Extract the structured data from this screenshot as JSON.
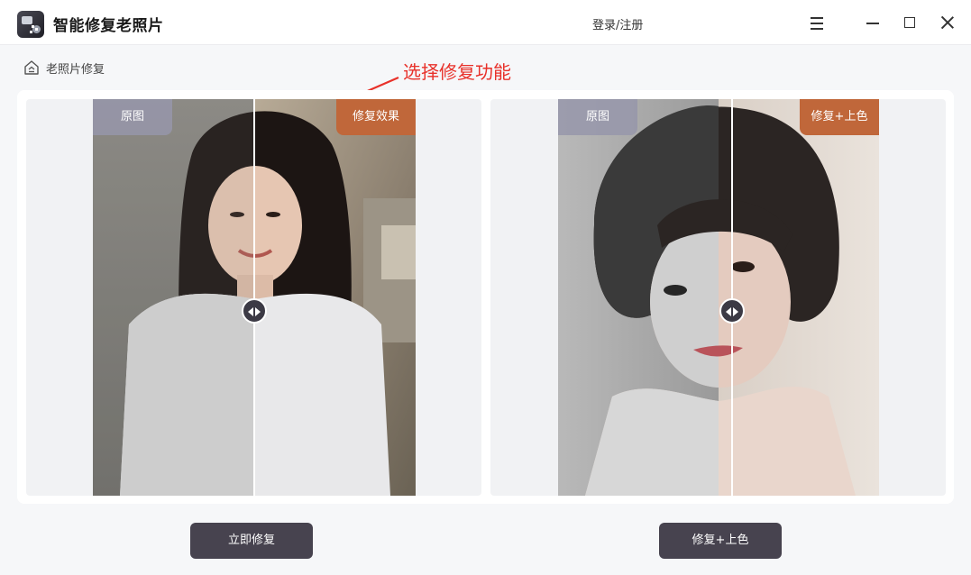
{
  "app": {
    "title": "智能修复老照片",
    "login_label": "登录/注册"
  },
  "breadcrumb": {
    "label": "老照片修复"
  },
  "annotation": {
    "text": "选择修复功能",
    "color": "#e8312a"
  },
  "compare_left": {
    "original_tag": "原图",
    "result_tag": "修复效果"
  },
  "compare_right": {
    "original_tag": "原图",
    "result_tag": "修复+上色"
  },
  "actions": {
    "repair_button": "立即修复",
    "colorize_button": "修复+上色"
  },
  "colors": {
    "accent_tag": "#c0673a",
    "button_bg": "#47434f",
    "original_tag": "#9696aa"
  },
  "icons": [
    "app-logo-icon",
    "menu-icon",
    "minimize-icon",
    "maximize-icon",
    "close-icon",
    "home-icon",
    "slider-handle-icon"
  ]
}
